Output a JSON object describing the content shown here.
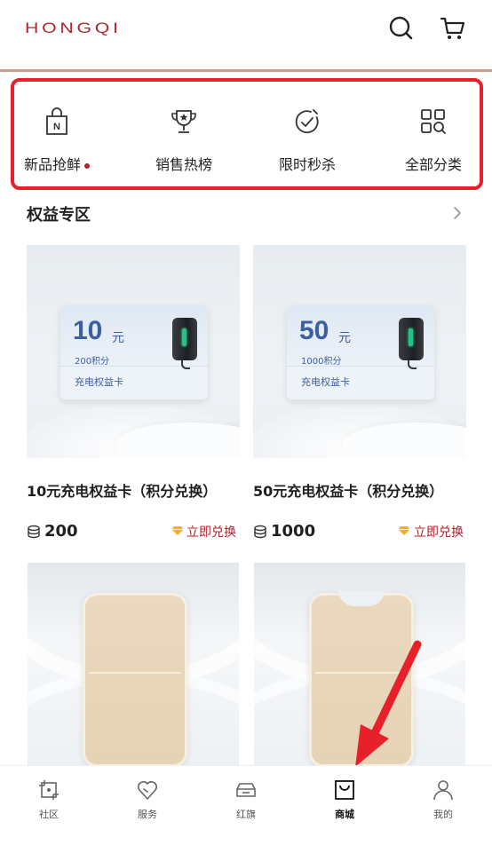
{
  "header": {
    "logo": "HONGQI",
    "search_icon": "search-icon",
    "cart_icon": "cart-icon"
  },
  "quick_nav": {
    "items": [
      {
        "label": "新品抢鲜",
        "icon": "new-bag-icon",
        "dot": true
      },
      {
        "label": "销售热榜",
        "icon": "trophy-icon"
      },
      {
        "label": "限时秒杀",
        "icon": "timer-check-icon"
      },
      {
        "label": "全部分类",
        "icon": "grid-search-icon"
      }
    ]
  },
  "section": {
    "title": "权益专区",
    "more_icon": "chevron-right-icon"
  },
  "products": [
    {
      "title": "10元充电权益卡（积分兑换）",
      "voucher_amount": "10",
      "voucher_unit": "元",
      "voucher_points": "200积分",
      "voucher_name": "充电权益卡",
      "price": "200",
      "redeem_label": "立即兑换"
    },
    {
      "title": "50元充电权益卡（积分兑换）",
      "voucher_amount": "50",
      "voucher_unit": "元",
      "voucher_points": "1000积分",
      "voucher_name": "充电权益卡",
      "price": "1000",
      "redeem_label": "立即兑换"
    }
  ],
  "bottom_nav": {
    "items": [
      {
        "label": "社区",
        "icon": "community-icon"
      },
      {
        "label": "服务",
        "icon": "heart-service-icon"
      },
      {
        "label": "红旗",
        "icon": "car-icon"
      },
      {
        "label": "商城",
        "icon": "shopping-bag-icon",
        "active": true
      },
      {
        "label": "我的",
        "icon": "person-icon"
      }
    ]
  },
  "colors": {
    "brand_red": "#b3262e",
    "highlight_border": "#e8202a",
    "voucher_blue": "#3b5fa2",
    "redeem_red": "#b0232b",
    "gem_gold": "#f2b01e"
  }
}
